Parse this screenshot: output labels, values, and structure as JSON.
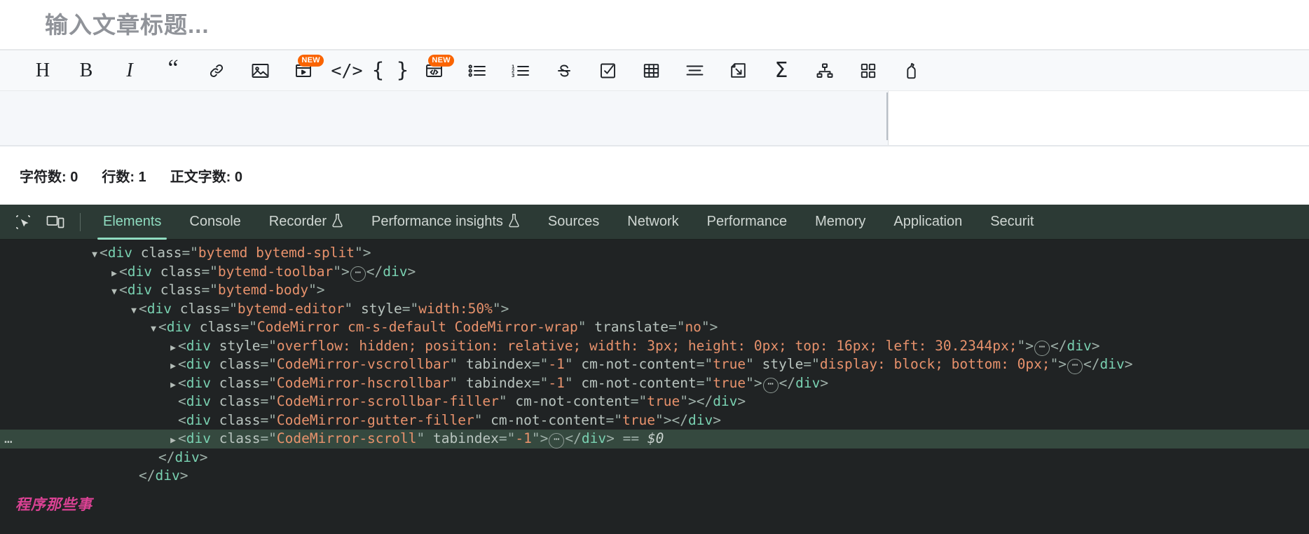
{
  "editor": {
    "title_placeholder": "输入文章标题...",
    "toolbar": [
      {
        "name": "heading",
        "glyph": "H",
        "badge": null
      },
      {
        "name": "bold",
        "glyph": "B",
        "badge": null
      },
      {
        "name": "italic",
        "glyph": "I",
        "badge": null
      },
      {
        "name": "quote",
        "glyph": "“",
        "badge": null
      },
      {
        "name": "link",
        "glyph": "",
        "badge": null
      },
      {
        "name": "image",
        "glyph": "",
        "badge": null
      },
      {
        "name": "video",
        "glyph": "",
        "badge": "NEW"
      },
      {
        "name": "code",
        "glyph": "</>",
        "badge": null
      },
      {
        "name": "code-block",
        "glyph": "{}",
        "badge": null
      },
      {
        "name": "code-window",
        "glyph": "",
        "badge": "NEW"
      },
      {
        "name": "bulleted-list",
        "glyph": "",
        "badge": null
      },
      {
        "name": "numbered-list",
        "glyph": "",
        "badge": null
      },
      {
        "name": "strikethrough",
        "glyph": "S",
        "badge": null
      },
      {
        "name": "task-list",
        "glyph": "",
        "badge": null
      },
      {
        "name": "table",
        "glyph": "",
        "badge": null
      },
      {
        "name": "align",
        "glyph": "",
        "badge": null
      },
      {
        "name": "insert-page",
        "glyph": "",
        "badge": null
      },
      {
        "name": "formula",
        "glyph": "Σ",
        "badge": null
      },
      {
        "name": "mindmap",
        "glyph": "",
        "badge": null
      },
      {
        "name": "grid-cards",
        "glyph": "",
        "badge": null
      },
      {
        "name": "highlighter",
        "glyph": "",
        "badge": null
      }
    ],
    "status": {
      "char_count": "字符数: 0",
      "line_count": "行数: 1",
      "body_word_count": "正文字数: 0"
    }
  },
  "devtools": {
    "toolbar_icons": [
      {
        "name": "inspect-element-icon"
      },
      {
        "name": "device-toolbar-icon"
      }
    ],
    "tabs": [
      {
        "label": "Elements",
        "active": true,
        "flask": false
      },
      {
        "label": "Console",
        "active": false,
        "flask": false
      },
      {
        "label": "Recorder",
        "active": false,
        "flask": true
      },
      {
        "label": "Performance insights",
        "active": false,
        "flask": true
      },
      {
        "label": "Sources",
        "active": false,
        "flask": false
      },
      {
        "label": "Network",
        "active": false,
        "flask": false
      },
      {
        "label": "Performance",
        "active": false,
        "flask": false
      },
      {
        "label": "Memory",
        "active": false,
        "flask": false
      },
      {
        "label": "Application",
        "active": false,
        "flask": false
      },
      {
        "label": "Securit",
        "active": false,
        "flask": false
      }
    ],
    "flask_glyph": "⚗",
    "dom_nodes": [
      {
        "indent": 0,
        "arrow": "open",
        "selected": false,
        "dots": false,
        "parts": [
          {
            "t": "punct",
            "s": "<"
          },
          {
            "t": "tag",
            "s": "div"
          },
          {
            "t": "sp",
            "s": " "
          },
          {
            "t": "attr",
            "s": "class"
          },
          {
            "t": "punct",
            "s": "=\""
          },
          {
            "t": "val",
            "s": "bytemd bytemd-split"
          },
          {
            "t": "punct",
            "s": "\">"
          }
        ]
      },
      {
        "indent": 1,
        "arrow": "closed",
        "selected": false,
        "dots": false,
        "parts": [
          {
            "t": "punct",
            "s": "<"
          },
          {
            "t": "tag",
            "s": "div"
          },
          {
            "t": "sp",
            "s": " "
          },
          {
            "t": "attr",
            "s": "class"
          },
          {
            "t": "punct",
            "s": "=\""
          },
          {
            "t": "val",
            "s": "bytemd-toolbar"
          },
          {
            "t": "punct",
            "s": "\">"
          },
          {
            "t": "pill",
            "s": "…"
          },
          {
            "t": "punct",
            "s": "</"
          },
          {
            "t": "tag",
            "s": "div"
          },
          {
            "t": "punct",
            "s": ">"
          }
        ]
      },
      {
        "indent": 1,
        "arrow": "open",
        "selected": false,
        "dots": false,
        "parts": [
          {
            "t": "punct",
            "s": "<"
          },
          {
            "t": "tag",
            "s": "div"
          },
          {
            "t": "sp",
            "s": " "
          },
          {
            "t": "attr",
            "s": "class"
          },
          {
            "t": "punct",
            "s": "=\""
          },
          {
            "t": "val",
            "s": "bytemd-body"
          },
          {
            "t": "punct",
            "s": "\">"
          }
        ]
      },
      {
        "indent": 2,
        "arrow": "open",
        "selected": false,
        "dots": false,
        "parts": [
          {
            "t": "punct",
            "s": "<"
          },
          {
            "t": "tag",
            "s": "div"
          },
          {
            "t": "sp",
            "s": " "
          },
          {
            "t": "attr",
            "s": "class"
          },
          {
            "t": "punct",
            "s": "=\""
          },
          {
            "t": "val",
            "s": "bytemd-editor"
          },
          {
            "t": "punct",
            "s": "\" "
          },
          {
            "t": "attr",
            "s": "style"
          },
          {
            "t": "punct",
            "s": "=\""
          },
          {
            "t": "val",
            "s": "width:50%"
          },
          {
            "t": "punct",
            "s": "\">"
          }
        ]
      },
      {
        "indent": 3,
        "arrow": "open",
        "selected": false,
        "dots": false,
        "parts": [
          {
            "t": "punct",
            "s": "<"
          },
          {
            "t": "tag",
            "s": "div"
          },
          {
            "t": "sp",
            "s": " "
          },
          {
            "t": "attr",
            "s": "class"
          },
          {
            "t": "punct",
            "s": "=\""
          },
          {
            "t": "val",
            "s": "CodeMirror cm-s-default CodeMirror-wrap"
          },
          {
            "t": "punct",
            "s": "\" "
          },
          {
            "t": "attr",
            "s": "translate"
          },
          {
            "t": "punct",
            "s": "=\""
          },
          {
            "t": "val",
            "s": "no"
          },
          {
            "t": "punct",
            "s": "\">"
          }
        ]
      },
      {
        "indent": 4,
        "arrow": "closed",
        "selected": false,
        "dots": false,
        "parts": [
          {
            "t": "punct",
            "s": "<"
          },
          {
            "t": "tag",
            "s": "div"
          },
          {
            "t": "sp",
            "s": " "
          },
          {
            "t": "attr",
            "s": "style"
          },
          {
            "t": "punct",
            "s": "=\""
          },
          {
            "t": "val",
            "s": "overflow: hidden; position: relative; width: 3px; height: 0px; top: 16px; left: 30.2344px;"
          },
          {
            "t": "punct",
            "s": "\">"
          },
          {
            "t": "pill",
            "s": "…"
          },
          {
            "t": "punct",
            "s": "</"
          },
          {
            "t": "tag",
            "s": "div"
          },
          {
            "t": "punct",
            "s": ">"
          }
        ]
      },
      {
        "indent": 4,
        "arrow": "closed",
        "selected": false,
        "dots": false,
        "parts": [
          {
            "t": "punct",
            "s": "<"
          },
          {
            "t": "tag",
            "s": "div"
          },
          {
            "t": "sp",
            "s": " "
          },
          {
            "t": "attr",
            "s": "class"
          },
          {
            "t": "punct",
            "s": "=\""
          },
          {
            "t": "val",
            "s": "CodeMirror-vscrollbar"
          },
          {
            "t": "punct",
            "s": "\" "
          },
          {
            "t": "attr",
            "s": "tabindex"
          },
          {
            "t": "punct",
            "s": "=\""
          },
          {
            "t": "val",
            "s": "-1"
          },
          {
            "t": "punct",
            "s": "\" "
          },
          {
            "t": "attr",
            "s": "cm-not-content"
          },
          {
            "t": "punct",
            "s": "=\""
          },
          {
            "t": "val",
            "s": "true"
          },
          {
            "t": "punct",
            "s": "\" "
          },
          {
            "t": "attr",
            "s": "style"
          },
          {
            "t": "punct",
            "s": "=\""
          },
          {
            "t": "val",
            "s": "display: block; bottom: 0px;"
          },
          {
            "t": "punct",
            "s": "\">"
          },
          {
            "t": "pill",
            "s": "…"
          },
          {
            "t": "punct",
            "s": "</"
          },
          {
            "t": "tag",
            "s": "div"
          },
          {
            "t": "punct",
            "s": ">"
          }
        ]
      },
      {
        "indent": 4,
        "arrow": "closed",
        "selected": false,
        "dots": false,
        "parts": [
          {
            "t": "punct",
            "s": "<"
          },
          {
            "t": "tag",
            "s": "div"
          },
          {
            "t": "sp",
            "s": " "
          },
          {
            "t": "attr",
            "s": "class"
          },
          {
            "t": "punct",
            "s": "=\""
          },
          {
            "t": "val",
            "s": "CodeMirror-hscrollbar"
          },
          {
            "t": "punct",
            "s": "\" "
          },
          {
            "t": "attr",
            "s": "tabindex"
          },
          {
            "t": "punct",
            "s": "=\""
          },
          {
            "t": "val",
            "s": "-1"
          },
          {
            "t": "punct",
            "s": "\" "
          },
          {
            "t": "attr",
            "s": "cm-not-content"
          },
          {
            "t": "punct",
            "s": "=\""
          },
          {
            "t": "val",
            "s": "true"
          },
          {
            "t": "punct",
            "s": "\">"
          },
          {
            "t": "pill",
            "s": "…"
          },
          {
            "t": "punct",
            "s": "</"
          },
          {
            "t": "tag",
            "s": "div"
          },
          {
            "t": "punct",
            "s": ">"
          }
        ]
      },
      {
        "indent": 4,
        "arrow": "none",
        "selected": false,
        "dots": false,
        "parts": [
          {
            "t": "punct",
            "s": "<"
          },
          {
            "t": "tag",
            "s": "div"
          },
          {
            "t": "sp",
            "s": " "
          },
          {
            "t": "attr",
            "s": "class"
          },
          {
            "t": "punct",
            "s": "=\""
          },
          {
            "t": "val",
            "s": "CodeMirror-scrollbar-filler"
          },
          {
            "t": "punct",
            "s": "\" "
          },
          {
            "t": "attr",
            "s": "cm-not-content"
          },
          {
            "t": "punct",
            "s": "=\""
          },
          {
            "t": "val",
            "s": "true"
          },
          {
            "t": "punct",
            "s": "\">"
          },
          {
            "t": "punct",
            "s": "</"
          },
          {
            "t": "tag",
            "s": "div"
          },
          {
            "t": "punct",
            "s": ">"
          }
        ]
      },
      {
        "indent": 4,
        "arrow": "none",
        "selected": false,
        "dots": false,
        "parts": [
          {
            "t": "punct",
            "s": "<"
          },
          {
            "t": "tag",
            "s": "div"
          },
          {
            "t": "sp",
            "s": " "
          },
          {
            "t": "attr",
            "s": "class"
          },
          {
            "t": "punct",
            "s": "=\""
          },
          {
            "t": "val",
            "s": "CodeMirror-gutter-filler"
          },
          {
            "t": "punct",
            "s": "\" "
          },
          {
            "t": "attr",
            "s": "cm-not-content"
          },
          {
            "t": "punct",
            "s": "=\""
          },
          {
            "t": "val",
            "s": "true"
          },
          {
            "t": "punct",
            "s": "\">"
          },
          {
            "t": "punct",
            "s": "</"
          },
          {
            "t": "tag",
            "s": "div"
          },
          {
            "t": "punct",
            "s": ">"
          }
        ]
      },
      {
        "indent": 4,
        "arrow": "closed",
        "selected": true,
        "dots": true,
        "parts": [
          {
            "t": "punct",
            "s": "<"
          },
          {
            "t": "tag",
            "s": "div"
          },
          {
            "t": "sp",
            "s": " "
          },
          {
            "t": "attr",
            "s": "class"
          },
          {
            "t": "punct",
            "s": "=\""
          },
          {
            "t": "val",
            "s": "CodeMirror-scroll"
          },
          {
            "t": "punct",
            "s": "\" "
          },
          {
            "t": "attr",
            "s": "tabindex"
          },
          {
            "t": "punct",
            "s": "=\""
          },
          {
            "t": "val",
            "s": "-1"
          },
          {
            "t": "punct",
            "s": "\">"
          },
          {
            "t": "pill",
            "s": "…"
          },
          {
            "t": "punct",
            "s": "</"
          },
          {
            "t": "tag",
            "s": "div"
          },
          {
            "t": "punct",
            "s": ">"
          },
          {
            "t": "sp",
            "s": " "
          },
          {
            "t": "eq",
            "s": "=="
          },
          {
            "t": "sp",
            "s": " "
          },
          {
            "t": "dollar",
            "s": "$0"
          }
        ]
      },
      {
        "indent": 3,
        "arrow": "none",
        "selected": false,
        "dots": false,
        "parts": [
          {
            "t": "punct",
            "s": "</"
          },
          {
            "t": "tag",
            "s": "div"
          },
          {
            "t": "punct",
            "s": ">"
          }
        ]
      },
      {
        "indent": 2,
        "arrow": "none",
        "selected": false,
        "dots": false,
        "parts": [
          {
            "t": "punct",
            "s": "</"
          },
          {
            "t": "tag",
            "s": "div"
          },
          {
            "t": "punct",
            "s": ">"
          }
        ]
      }
    ],
    "watermark": "程序那些事"
  }
}
